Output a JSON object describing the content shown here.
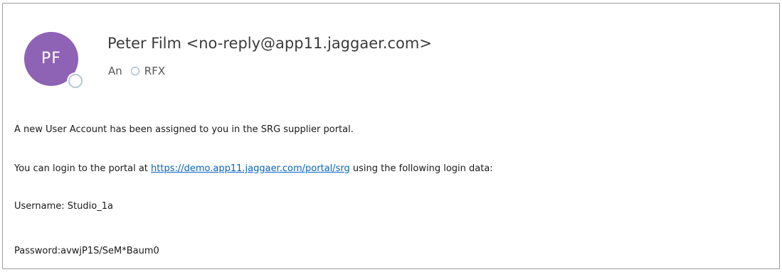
{
  "email": {
    "avatar_initials": "PF",
    "avatar_color": "#8e62b4",
    "sender": "Peter Film <no-reply@app11.jaggaer.com>",
    "to_prefix": "An",
    "recipient": "RFX",
    "body": {
      "line1": "A new User Account has been assigned to you in the SRG supplier portal.",
      "line2_before": "You can login to the portal at ",
      "line2_link": "https://demo.app11.jaggaer.com/portal/srg",
      "line2_after": " using the following login data:",
      "username_line": "Username: Studio_1a",
      "password_line": "Password:avwjP1S/SeM*Baum0"
    },
    "link_color": "#0563c1"
  }
}
